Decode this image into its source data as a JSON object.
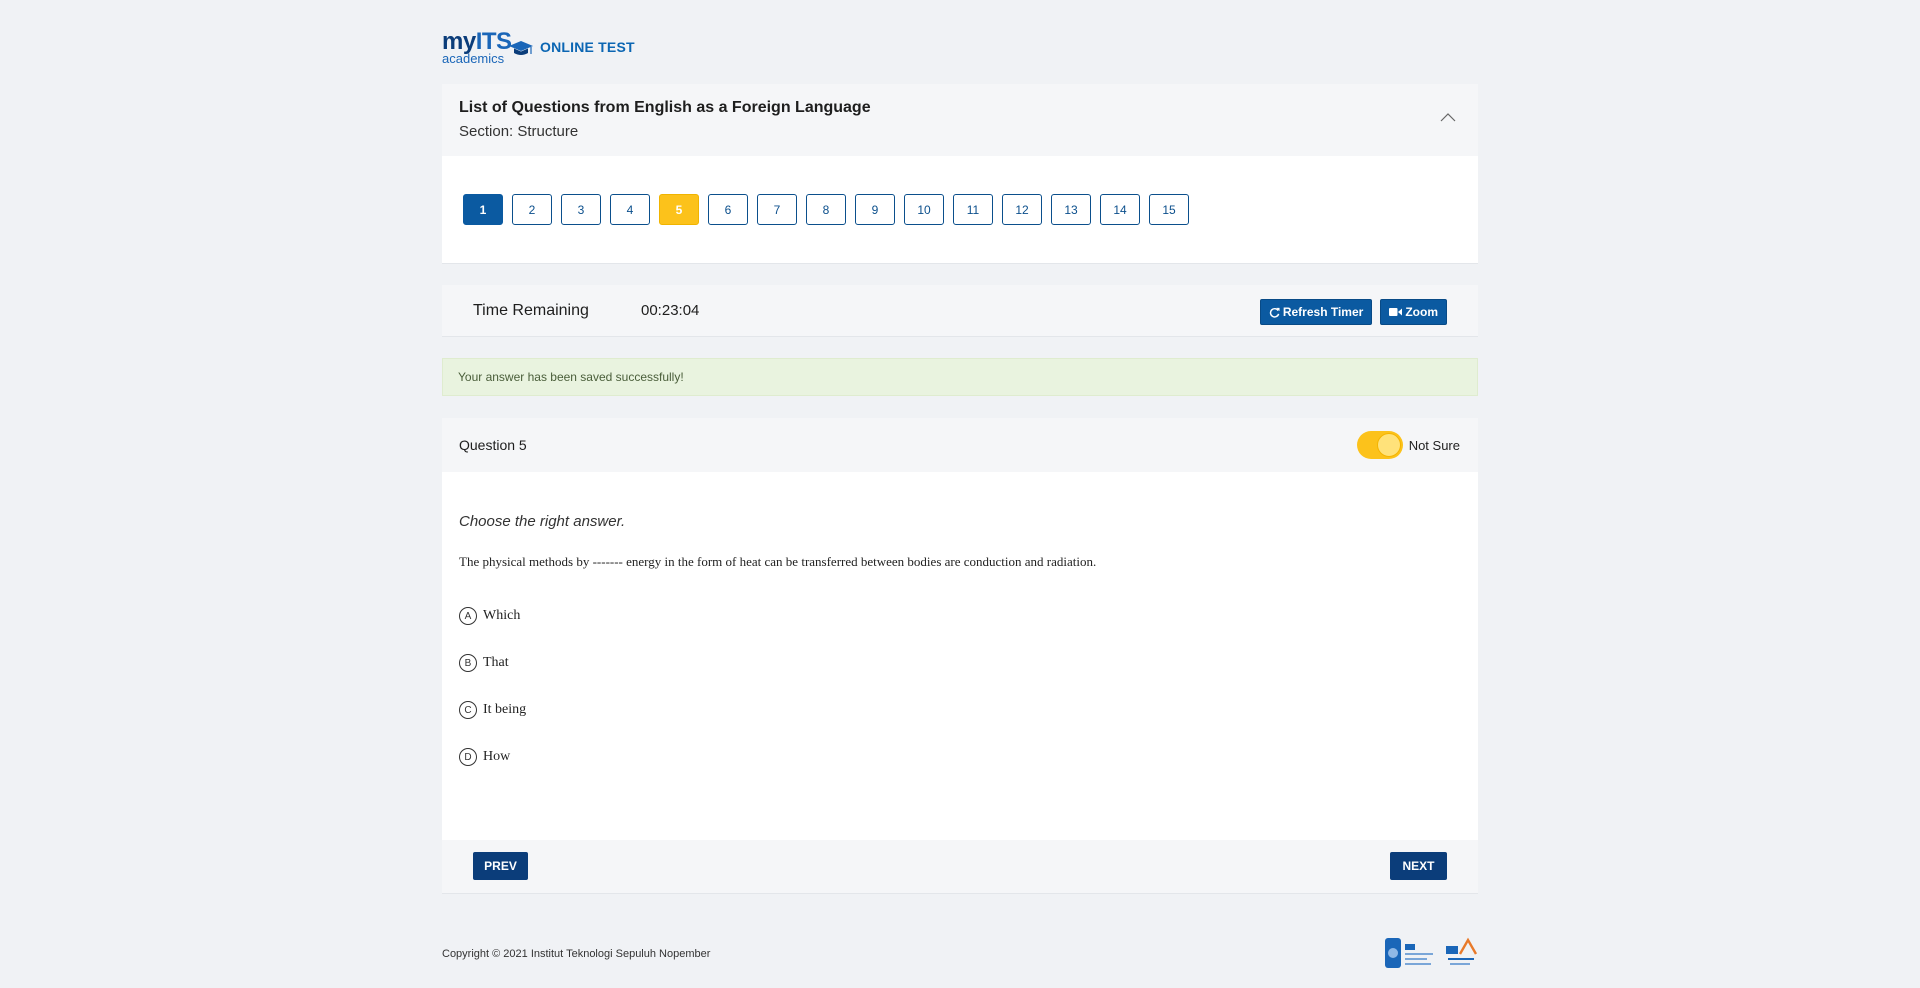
{
  "header": {
    "logo_main": "my",
    "logo_its": "ITS",
    "logo_sub": "academics",
    "app_title": "ONLINE TEST"
  },
  "question_list": {
    "title": "List of Questions from English as a Foreign Language",
    "section": "Section: Structure",
    "numbers": [
      "1",
      "2",
      "3",
      "4",
      "5",
      "6",
      "7",
      "8",
      "9",
      "10",
      "11",
      "12",
      "13",
      "14",
      "15"
    ],
    "active": "1",
    "marked_unsure": "5"
  },
  "timer": {
    "label": "Time Remaining",
    "value": "00:23:04",
    "refresh_label": "Refresh Timer",
    "zoom_label": "Zoom"
  },
  "alert": {
    "message": "Your answer has been saved successfully!"
  },
  "question": {
    "title": "Question 5",
    "not_sure_label": "Not Sure",
    "not_sure_checked": true,
    "instruction": "Choose the right answer.",
    "stem": "The physical methods by ------- energy in the form of heat can be transferred between bodies are conduction and radiation.",
    "options": [
      {
        "letter": "A",
        "text": "Which"
      },
      {
        "letter": "B",
        "text": "That"
      },
      {
        "letter": "C",
        "text": "It being"
      },
      {
        "letter": "D",
        "text": "How"
      }
    ],
    "prev_label": "PREV",
    "next_label": "NEXT"
  },
  "footer": {
    "copyright": "Copyright © 2021 Institut Teknologi Sepuluh Nopember"
  },
  "colors": {
    "primary": "#0b5aa1",
    "dark_primary": "#0b3d7a",
    "unsure": "#fcc21b",
    "alert_bg": "#e9f3df"
  }
}
